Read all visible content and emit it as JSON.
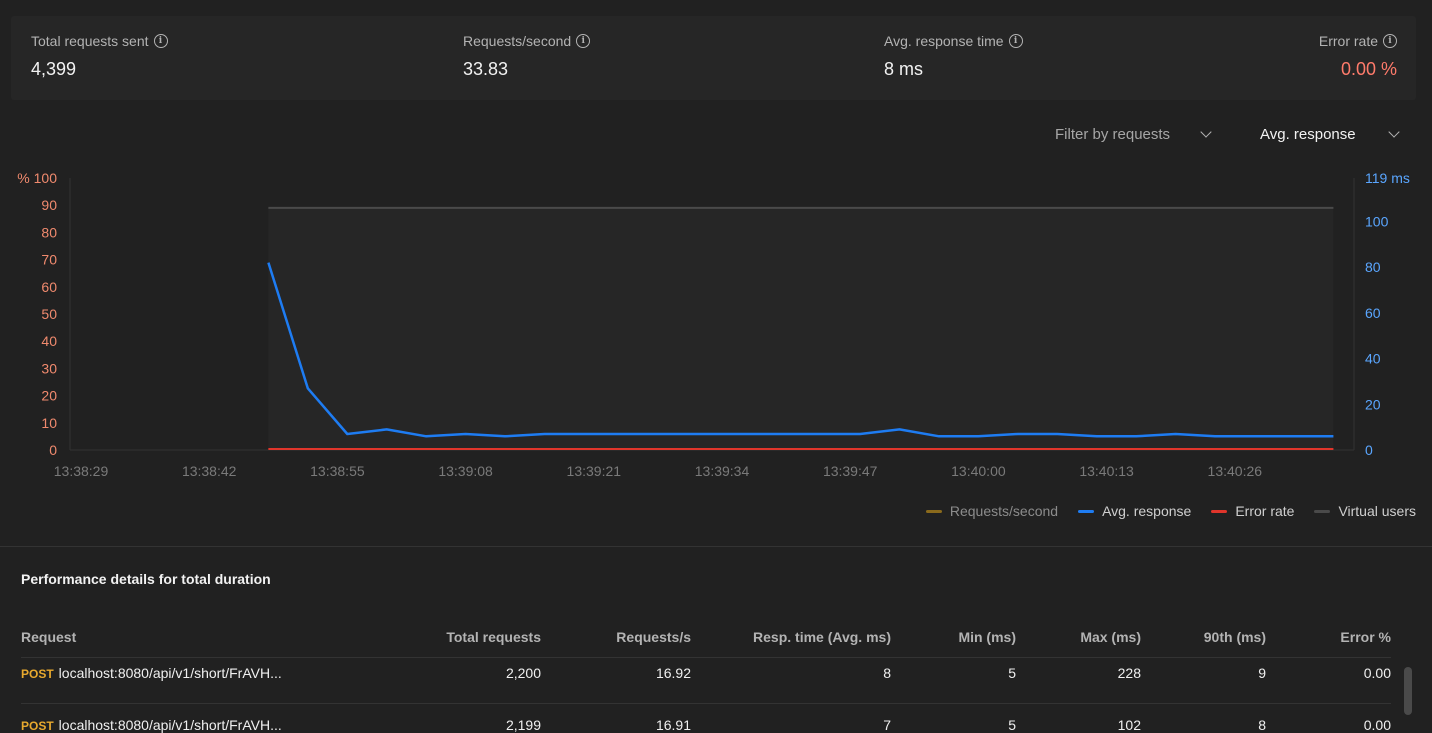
{
  "stats": {
    "total": {
      "label": "Total requests sent",
      "value": "4,399"
    },
    "rps": {
      "label": "Requests/second",
      "value": "33.83"
    },
    "avg": {
      "label": "Avg. response time",
      "value": "8 ms"
    },
    "error": {
      "label": "Error rate",
      "value": "0.00 %"
    }
  },
  "filters": {
    "requests": "Filter by requests",
    "metric": "Avg. response"
  },
  "chart_data": {
    "type": "line",
    "x": [
      "13:38:29",
      "13:38:42",
      "13:38:55",
      "13:39:08",
      "13:39:21",
      "13:39:34",
      "13:39:47",
      "13:40:00",
      "13:40:13",
      "13:40:26"
    ],
    "left_axis": {
      "unit": "%",
      "ticks": [
        "% 100",
        "90",
        "80",
        "70",
        "60",
        "50",
        "40",
        "30",
        "20",
        "10",
        "0"
      ],
      "ylim": [
        0,
        100
      ]
    },
    "right_axis": {
      "unit": "ms",
      "ticks": [
        "119 ms",
        "100",
        "80",
        "60",
        "40",
        "20",
        "0"
      ],
      "ylim": [
        0,
        119
      ]
    },
    "series": [
      {
        "name": "Avg. response",
        "color": "#1e7cf2",
        "axis": "right",
        "times": [
          "13:38:48",
          "13:38:52",
          "13:38:56",
          "13:39:00",
          "13:39:04",
          "13:39:08",
          "13:39:12",
          "13:39:16",
          "13:39:20",
          "13:39:24",
          "13:39:28",
          "13:39:32",
          "13:39:36",
          "13:39:40",
          "13:39:44",
          "13:39:48",
          "13:39:52",
          "13:39:56",
          "13:40:00",
          "13:40:04",
          "13:40:08",
          "13:40:12",
          "13:40:16",
          "13:40:20",
          "13:40:24",
          "13:40:28",
          "13:40:32",
          "13:40:36"
        ],
        "values": [
          82,
          27,
          7,
          9,
          6,
          7,
          6,
          7,
          7,
          7,
          7,
          7,
          7,
          7,
          7,
          7,
          9,
          6,
          6,
          7,
          7,
          6,
          6,
          7,
          6,
          6,
          6,
          6
        ]
      },
      {
        "name": "Error rate",
        "color": "#e0352b",
        "axis": "left",
        "values": [
          0
        ]
      },
      {
        "name": "Virtual users",
        "color": "#4a4a4a",
        "axis": "left",
        "values": [
          89
        ]
      },
      {
        "name": "Requests/second",
        "color": "#8a6a1c",
        "axis": "left",
        "values": []
      }
    ]
  },
  "legend": [
    "Requests/second",
    "Avg. response",
    "Error rate",
    "Virtual users"
  ],
  "details": {
    "title": "Performance details for total duration",
    "columns": [
      "Request",
      "Total requests",
      "Requests/s",
      "Resp. time (Avg. ms)",
      "Min (ms)",
      "Max (ms)",
      "90th (ms)",
      "Error %"
    ],
    "rows": [
      {
        "method": "POST",
        "url": "localhost:8080/api/v1/short/FrAVH...",
        "total": "2,200",
        "rps": "16.92",
        "avg": "8",
        "min": "5",
        "max": "228",
        "p90": "9",
        "err": "0.00"
      },
      {
        "method": "POST",
        "url": "localhost:8080/api/v1/short/FrAVH...",
        "total": "2,199",
        "rps": "16.91",
        "avg": "7",
        "min": "5",
        "max": "102",
        "p90": "8",
        "err": "0.00"
      }
    ]
  }
}
